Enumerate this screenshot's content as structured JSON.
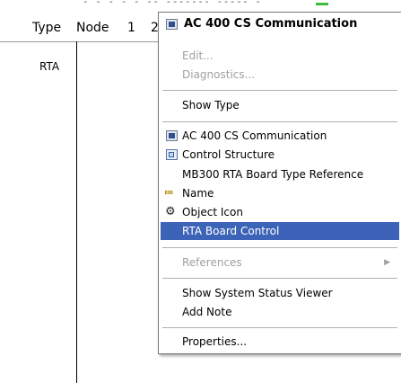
{
  "list_view": {
    "columns": [
      "Type",
      "Node",
      "1",
      "2"
    ],
    "top_strip_text": "- - - - -  -- ------- ----- -",
    "rows": [
      {
        "type": "RTA"
      }
    ]
  },
  "context_menu": {
    "title": "AC 400 CS Communication",
    "items": {
      "edit": "Edit...",
      "diagnostics": "Diagnostics...",
      "show_type": "Show Type",
      "ac400": "AC 400 CS Communication",
      "control_structure": "Control Structure",
      "mb300": "MB300 RTA Board Type Reference",
      "name": "Name",
      "object_icon": "Object Icon",
      "rta_board_control": "RTA Board Control",
      "references": "References",
      "show_system_status": "Show System Status Viewer",
      "add_note": "Add Note",
      "properties": "Properties..."
    }
  },
  "colors": {
    "selection": "#3d63b8",
    "disabled_text": "#a0a0a0"
  }
}
